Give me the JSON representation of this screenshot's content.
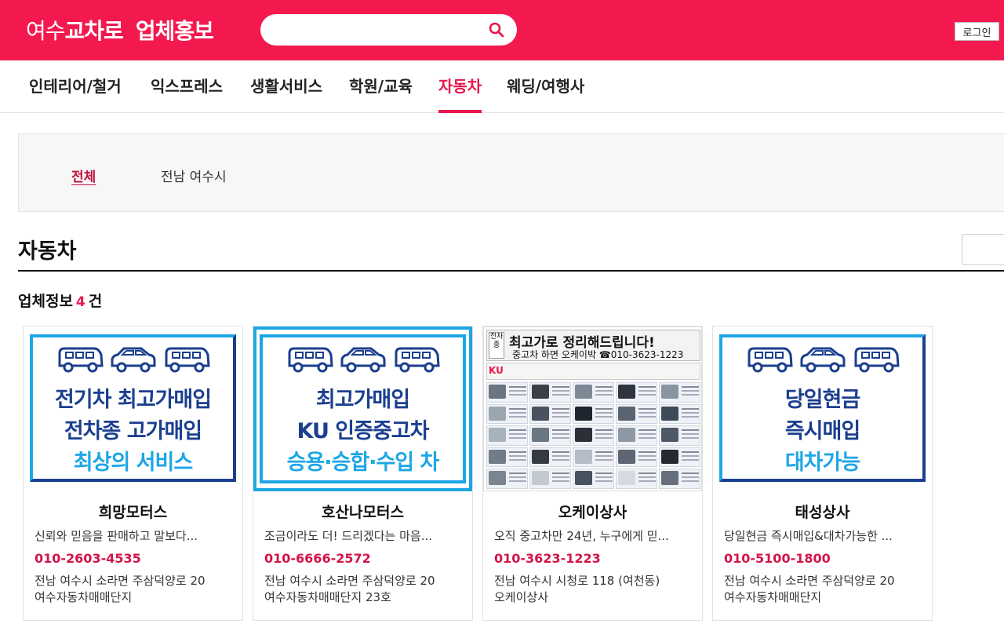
{
  "header": {
    "logo_region": "여수",
    "logo_brand": "교차로",
    "logo_section": "업체홍보",
    "search_placeholder": "",
    "login_label": "로그인",
    "brand_color": "#f3194f"
  },
  "nav": {
    "items": [
      {
        "label": "인테리어/철거"
      },
      {
        "label": "익스프레스"
      },
      {
        "label": "생활서비스"
      },
      {
        "label": "학원/교육"
      },
      {
        "label": "자동차",
        "active": true
      },
      {
        "label": "웨딩/여행사"
      }
    ]
  },
  "filter": {
    "items": [
      {
        "label": "전체",
        "active": true
      },
      {
        "label": "전남 여수시"
      }
    ]
  },
  "section": {
    "title": "자동차",
    "count_prefix": "업체정보",
    "count": "4",
    "count_suffix": "건"
  },
  "cards": [
    {
      "name": "희망모터스",
      "desc": "신뢰와 믿음을 판매하고 말보다...",
      "phone": "010-2603-4535",
      "addr_line1": "전남 여수시 소라면 주삼덕양로 20",
      "addr_line2": "여수자동차매매단지",
      "banner_lines": [
        "전기차 최고가매입",
        "전차종 고가매입",
        "최상의 서비스"
      ]
    },
    {
      "name": "호산나모터스",
      "desc": "조금이라도 더! 드리겠다는 마음...",
      "phone": "010-6666-2572",
      "addr_line1": "전남 여수시 소라면 주삼덕양로 20",
      "addr_line2": "여수자동차매매단지 23호",
      "banner_lines": [
        "최고가매입",
        "KU 인증중고차",
        "승용·승합·수입 차"
      ]
    },
    {
      "name": "오케이상사",
      "desc": "오직 중고차만 24년, 누구에게 믿...",
      "phone": "010-3623-1223",
      "addr_line1": "전남 여수시 시청로 118 (여천동)",
      "addr_line2": "오케이상사",
      "banner_tag": "전차종",
      "banner_title": "최고가로 정리해드립니다!",
      "banner_sub": "중고차 하면 오케이박 ☎010-3623-1223",
      "banner_logo": "KU"
    },
    {
      "name": "태성상사",
      "desc": "당일현금 즉시매입&대차가능한 ...",
      "phone": "010-5100-1800",
      "addr_line1": "전남 여수시 소라면 주삼덕양로 20",
      "addr_line2": "여수자동차매매단지",
      "banner_lines": [
        "당일현금",
        "즉시매입",
        "대차가능"
      ]
    }
  ]
}
